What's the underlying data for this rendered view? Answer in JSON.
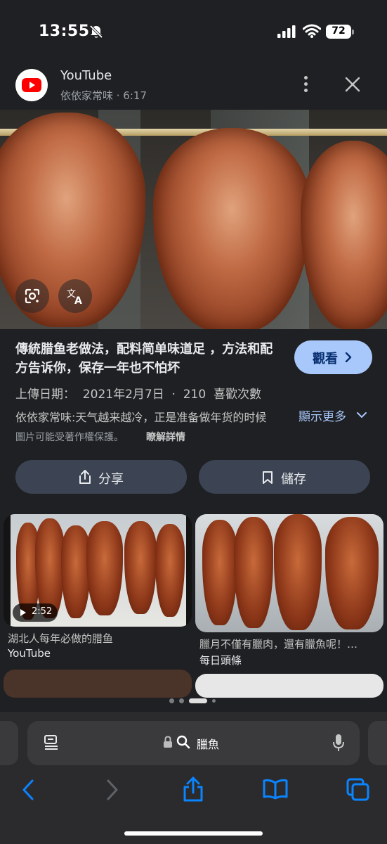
{
  "status_bar": {
    "time": "13:55",
    "battery": "72"
  },
  "source": {
    "name": "YouTube",
    "subtitle": "依依家常味 · 6:17",
    "icons": [
      "youtube-logo",
      "more-vert-icon",
      "close-icon"
    ]
  },
  "hero": {
    "buttons": [
      "google-lens-icon",
      "translate-icon"
    ]
  },
  "result": {
    "title": "傳統腊鱼老做法，配料简单味道足 ，方法和配方告诉你，保存一年也不怕坏",
    "watch_label": "觀看",
    "upload_info": "上傳日期：  2021年2月7日  ·  210  喜歡次數",
    "description": "依依家常味:天气越来越冷，正是准备做年货的时候",
    "show_more": "顯示更多",
    "copyright": "圖片可能受著作權保護。",
    "learn_more": "瞭解詳情"
  },
  "actions": {
    "share_label": "分享",
    "save_label": "儲存"
  },
  "related": [
    {
      "title": "湖北人每年必做的腊鱼",
      "source": "YouTube",
      "duration": "2:52"
    },
    {
      "title": "臘月不僅有臘肉，還有臘魚呢！…",
      "source": "每日頭條"
    }
  ],
  "pagination": {
    "total": 4,
    "active": 2
  },
  "browser": {
    "query": "臘魚",
    "toolbar": [
      "back-icon",
      "forward-icon",
      "share-icon",
      "bookmarks-icon",
      "tabs-icon"
    ]
  },
  "colors": {
    "background": "#1f2023",
    "accent": "#a8c7fa",
    "action_button": "#3c4453",
    "ios_blue": "#0a84ff"
  }
}
